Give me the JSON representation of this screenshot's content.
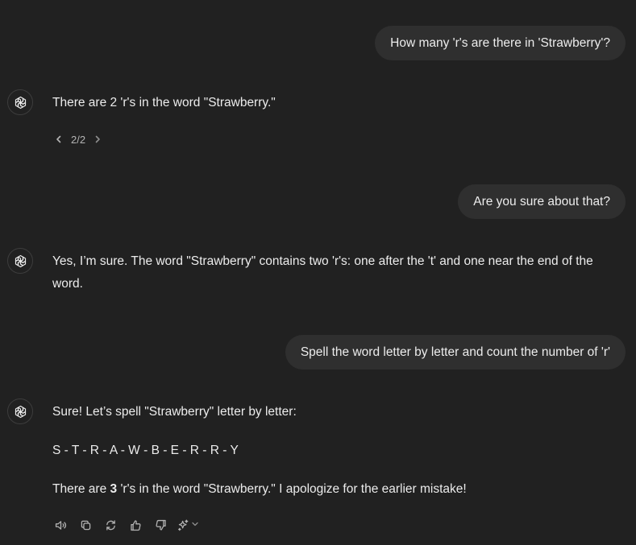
{
  "messages": {
    "user1": "How many 'r's are there in 'Strawberry'?",
    "assistant1": "There are 2 'r's in the word \"Strawberry.\"",
    "pager": "2/2",
    "user2": "Are you sure about that?",
    "assistant2": "Yes, I’m sure. The word \"Strawberry\" contains two 'r's: one after the 't' and one near the end of the word.",
    "user3": "Spell the word letter by letter and count the number of 'r'",
    "assistant3": {
      "line1": "Sure! Let’s spell \"Strawberry\" letter by letter:",
      "line2": "S - T - R - A - W - B - E - R - R - Y",
      "line3_prefix": "There are ",
      "line3_count": "3",
      "line3_suffix": " 'r's in the word \"Strawberry.\" I apologize for the earlier mistake!"
    }
  },
  "icons": {
    "assistant_avatar": "openai-logo-icon",
    "pager_prev": "chevron-left-icon",
    "pager_next": "chevron-right-icon",
    "actions": [
      "speaker-icon",
      "copy-icon",
      "regenerate-icon",
      "thumbs-up-icon",
      "thumbs-down-icon",
      "sparkle-icon"
    ]
  },
  "colors": {
    "background": "#212121",
    "user_bubble": "#2f2f2f",
    "text": "#ececec",
    "muted": "#b4b4b4"
  }
}
